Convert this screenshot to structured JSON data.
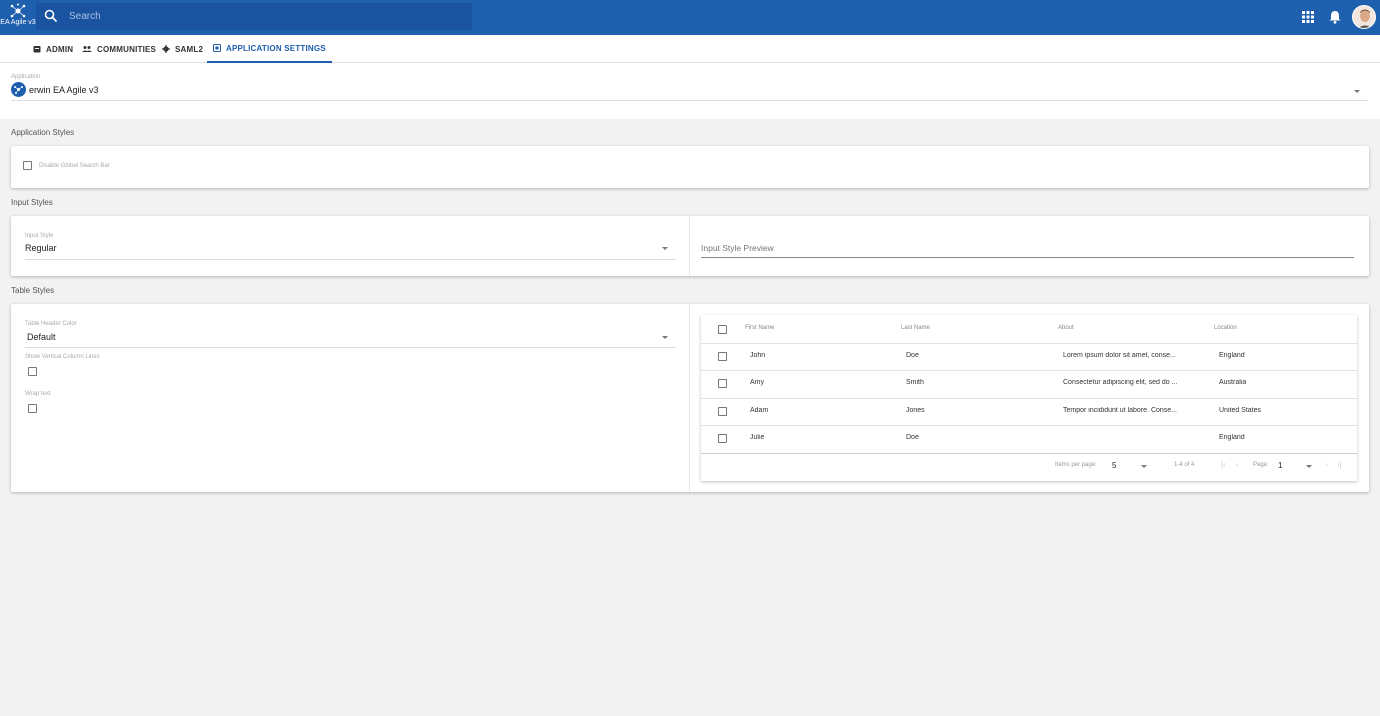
{
  "header": {
    "logo_text": "EA Agile v3",
    "search_placeholder": "Search"
  },
  "tabs": [
    {
      "label": "ADMIN",
      "icon": "admin-icon"
    },
    {
      "label": "COMMUNITIES",
      "icon": "people-icon"
    },
    {
      "label": "SAML2",
      "icon": "gear-icon"
    },
    {
      "label": "APPLICATION SETTINGS",
      "icon": "settings-icon",
      "active": true
    }
  ],
  "application": {
    "label": "Application",
    "value": "erwin EA Agile v3"
  },
  "app_styles": {
    "title": "Application Styles",
    "disable_search_label": "Disable Global Search Bar"
  },
  "input_styles": {
    "title": "Input Styles",
    "input_style_label": "Input Style",
    "input_style_value": "Regular",
    "preview_placeholder": "Input Style Preview"
  },
  "table_styles": {
    "title": "Table Styles",
    "header_color_label": "Table Header Color",
    "header_color_value": "Default",
    "vertical_lines_label": "Show Vertical Column Lines",
    "wrap_text_label": "Wrap text"
  },
  "table": {
    "columns": [
      "First Name",
      "Last Name",
      "About",
      "Location"
    ],
    "rows": [
      [
        "John",
        "Doe",
        "Lorem ipsum dolor sit amet, conse...",
        "England"
      ],
      [
        "Amy",
        "Smith",
        "Consectetur adipiscing elit, sed do ...",
        "Australia"
      ],
      [
        "Adam",
        "Jones",
        "Tempor incididunt ut labore. Conse...",
        "United States"
      ],
      [
        "Julie",
        "Doe",
        "",
        "England"
      ]
    ],
    "paginator": {
      "items_per_page_label": "Items per page:",
      "items_per_page": "5",
      "range": "1-4 of 4",
      "page_label": "Page:",
      "page": "1"
    }
  },
  "colors": {
    "primary": "#1e5fae",
    "background": "#f2f2f2"
  }
}
